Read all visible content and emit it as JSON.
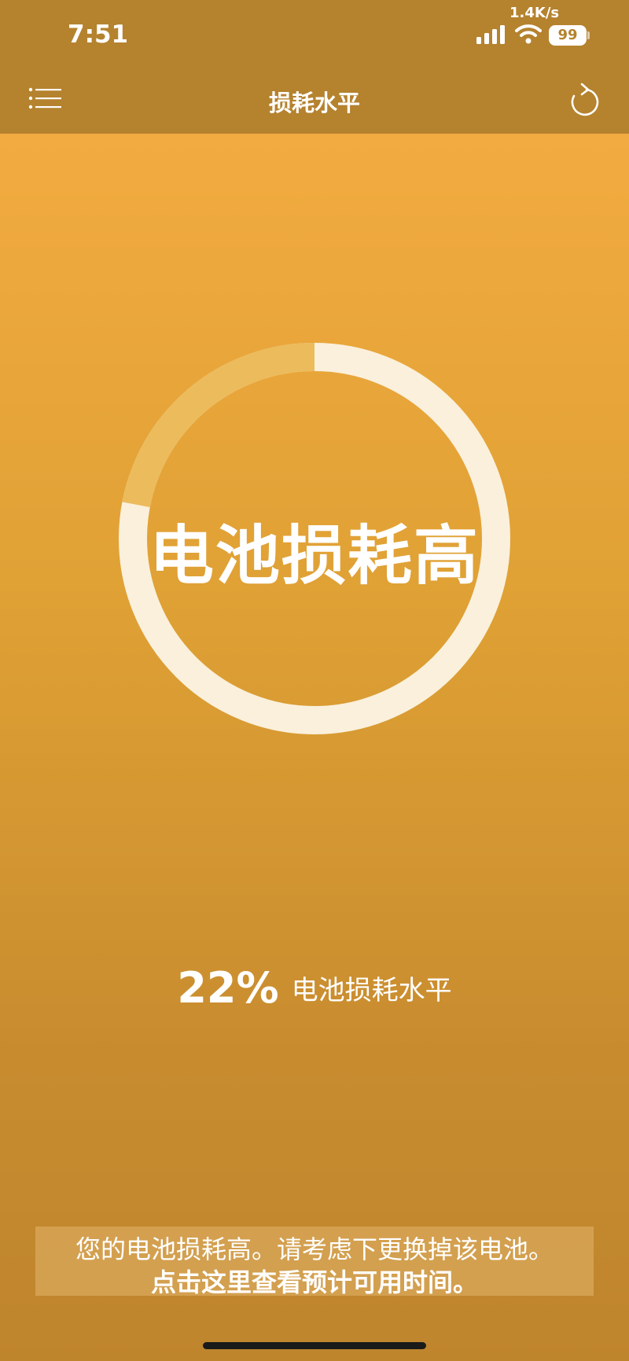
{
  "status_bar": {
    "time": "7:51",
    "net_speed": "1.4K/s",
    "battery_level": "99"
  },
  "header": {
    "title": "损耗水平",
    "menu_icon": "list-menu-icon",
    "refresh_icon": "refresh-icon"
  },
  "gauge": {
    "label": "电池损耗高",
    "wear_fraction": 0.22,
    "ring_color": "#faf0dc",
    "wear_color": "#ecbb5c"
  },
  "stats": {
    "value": "22%",
    "label": "电池损耗水平"
  },
  "banner": {
    "line1": "您的电池损耗高。请考虑下更换掉该电池。",
    "line2": "点击这里查看预计可用时间。"
  },
  "colors": {
    "header_bg": "#b5822e",
    "gradient_top": "#f2ab40",
    "gradient_bottom": "#bf852d"
  }
}
